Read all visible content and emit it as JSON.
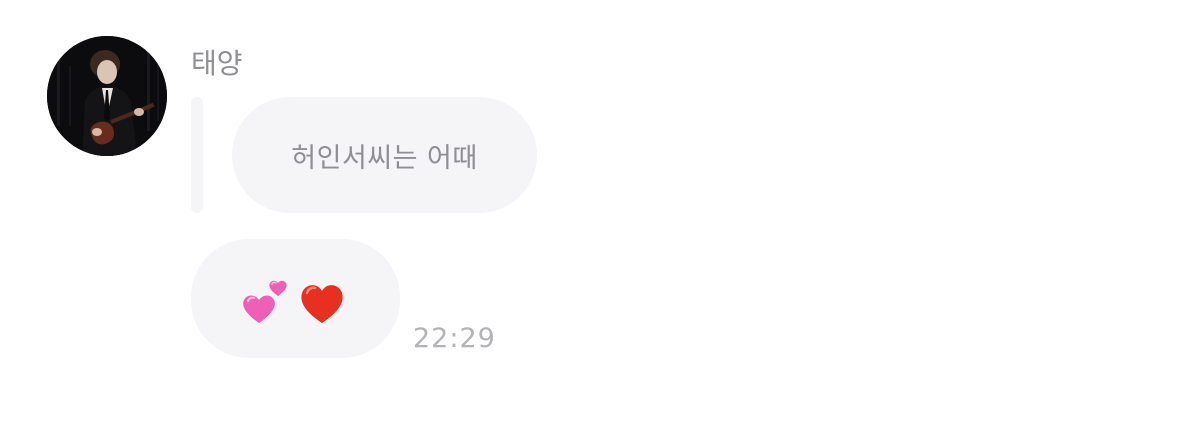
{
  "message": {
    "sender_name": "태양",
    "quoted_text": "허인서씨는 어때",
    "emoji_content": [
      "two-hearts",
      "red-heart"
    ],
    "timestamp": "22:29"
  },
  "colors": {
    "bubble_bg": "#f5f5f7",
    "secondary_text": "#8e8e93",
    "timestamp_text": "#b3b3b8",
    "pink_heart": "#f05fb7",
    "red_heart": "#e8301f"
  }
}
